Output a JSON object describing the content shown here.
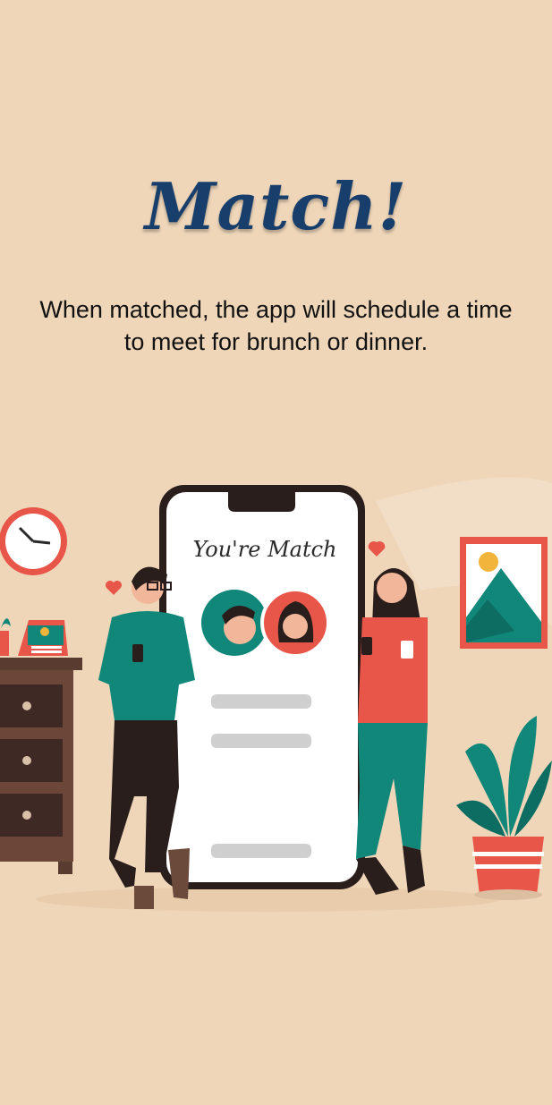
{
  "screen": {
    "title": "Match!",
    "description": "When matched, the app will schedule a time to meet for brunch or dinner."
  },
  "illustration": {
    "phone_header": "You're Match",
    "colors": {
      "background": "#efd6b9",
      "title": "#183f6b",
      "teal": "#11877a",
      "coral": "#e8564a",
      "dark": "#2a1e1c"
    }
  }
}
